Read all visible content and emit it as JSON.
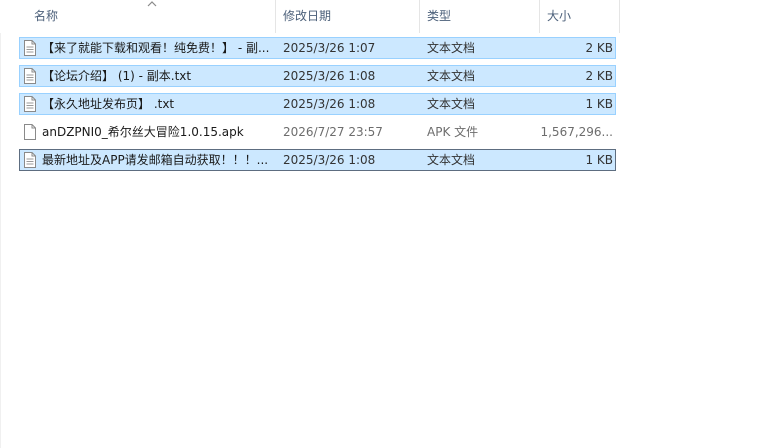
{
  "columns": {
    "name": "名称",
    "date": "修改日期",
    "type": "类型",
    "size": "大小"
  },
  "files": [
    {
      "name": "【来了就能下载和观看！纯免费！】 - 副...",
      "date": "2025/3/26 1:07",
      "type": "文本文档",
      "size": "2 KB",
      "icon": "text-file-icon",
      "selected": true
    },
    {
      "name": "【论坛介绍】 (1) - 副本.txt",
      "date": "2025/3/26 1:08",
      "type": "文本文档",
      "size": "2 KB",
      "icon": "text-file-icon",
      "selected": true
    },
    {
      "name": "【永久地址发布页】 .txt",
      "date": "2025/3/26 1:08",
      "type": "文本文档",
      "size": "1 KB",
      "icon": "text-file-icon",
      "selected": true
    },
    {
      "name": "anDZPNI0_希尔丝大冒险1.0.15.apk",
      "date": "2026/7/27 23:57",
      "type": "APK 文件",
      "size": "1,567,296...",
      "icon": "file-icon",
      "selected": false
    },
    {
      "name": "最新地址及APP请发邮箱自动获取！！！...",
      "date": "2025/3/26 1:08",
      "type": "文本文档",
      "size": "1 KB",
      "icon": "text-file-icon",
      "selected": true,
      "focused": true
    }
  ]
}
